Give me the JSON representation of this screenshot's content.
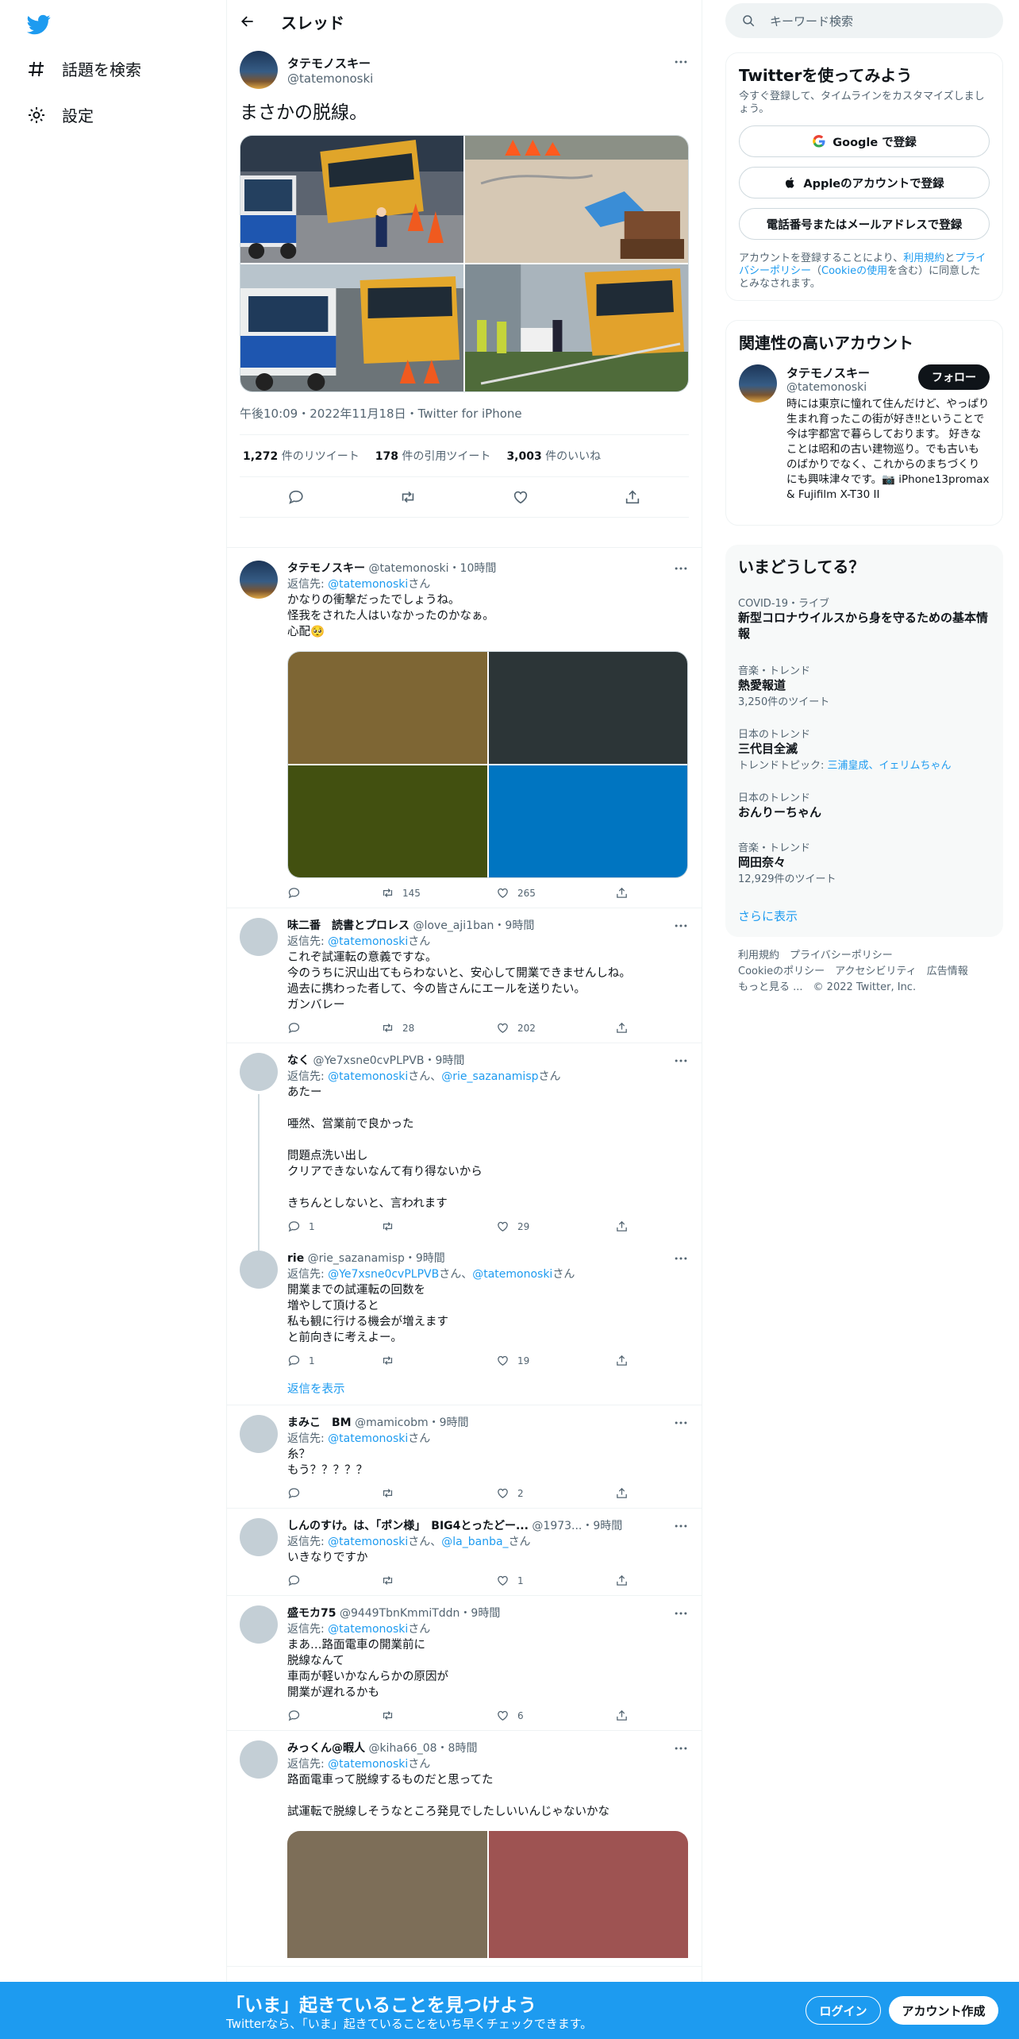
{
  "nav": {
    "explore_label": "話題を検索",
    "settings_label": "設定"
  },
  "header": {
    "title": "スレッド"
  },
  "focus_tweet": {
    "name": "タテモノスキー",
    "handle": "@tatemonoski",
    "text": "まさかの脱線。",
    "meta": "午後10:09・2022年11月18日・Twitter for iPhone",
    "retweets_count": "1,272",
    "retweets_label": " 件のリツイート",
    "quotes_count": "178",
    "quotes_label": " 件の引用ツイート",
    "likes_count": "3,003",
    "likes_label": " 件のいいね"
  },
  "replies": [
    {
      "name": "タテモノスキー",
      "handle": "@tatemonoski",
      "time": "・10時間",
      "to_prefix": "返信先: ",
      "to": "@tatemonoski",
      "to_suffix": "さん",
      "body": "かなりの衝撃だったでしょうね。\n怪我をされた人はいなかったのかなぁ。\n心配🥺",
      "replies": "",
      "retweets": "145",
      "likes": "265",
      "media_colors": [
        "#7e6634",
        "#2c3537",
        "#425010",
        "#0075c1"
      ]
    },
    {
      "name": "味二番　読書とプロレス",
      "handle": "@love_aji1ban",
      "time": "・9時間",
      "to_prefix": "返信先: ",
      "to": "@tatemonoski",
      "to_suffix": "さん",
      "body": "これぞ試運転の意義ですな。\n今のうちに沢山出てもらわないと、安心して開業できませんしね。\n過去に携わった者して、今の皆さんにエールを送りたい。\nガンバレー",
      "replies": "",
      "retweets": "28",
      "likes": "202"
    },
    {
      "name": "なく",
      "handle": "@Ye7xsne0cvPLPVB",
      "time": "・9時間",
      "to_prefix": "返信先: ",
      "to": "@tatemonoski",
      "to_mid": "さん、",
      "to2": "@rie_sazanamisp",
      "to_suffix": "さん",
      "body": "あたー\n\n唖然、営業前で良かった\n\n問題点洗い出し\nクリアできないなんて有り得ないから\n\nきちんとしないと、言われます",
      "replies": "1",
      "retweets": "",
      "likes": "29"
    },
    {
      "name": "rie",
      "handle": "@rie_sazanamisp",
      "time": "・9時間",
      "to_prefix": "返信先: ",
      "to": "@Ye7xsne0cvPLPVB",
      "to_mid": "さん、",
      "to2": "@tatemonoski",
      "to_suffix": "さん",
      "body": "開業までの試運転の回数を\n増やして頂けると\n私も観に行ける機会が増えます\nと前向きに考えよー。",
      "replies": "1",
      "retweets": "",
      "likes": "19",
      "show_replies": "返信を表示"
    },
    {
      "name": "まみこ　BM",
      "handle": "@mamicobm",
      "time": "・9時間",
      "to_prefix": "返信先: ",
      "to": "@tatemonoski",
      "to_suffix": "さん",
      "body": "糸？\nもう？？？？？",
      "replies": "",
      "retweets": "",
      "likes": "2"
    },
    {
      "name": "しんのすけ。は、「ポン様」　BIG4とったどー...",
      "handle": "@1973...",
      "time": "・9時間",
      "to_prefix": "返信先: ",
      "to": "@tatemonoski",
      "to_mid": "さん、",
      "to2": "@la_banba_",
      "to_suffix": "さん",
      "body": "いきなりですか",
      "replies": "",
      "retweets": "",
      "likes": "1"
    },
    {
      "name": "盛モカ75",
      "handle": "@9449TbnKmmiTddn",
      "time": "・9時間",
      "to_prefix": "返信先: ",
      "to": "@tatemonoski",
      "to_suffix": "さん",
      "body": "まあ…路面電車の開業前に\n脱線なんて\n車両が軽いかなんらかの原因が\n開業が遅れるかも",
      "replies": "",
      "retweets": "",
      "likes": "6"
    },
    {
      "name": "みっくん@暇人",
      "handle": "@kiha66_08",
      "time": "・8時間",
      "to_prefix": "返信先: ",
      "to": "@tatemonoski",
      "to_suffix": "さん",
      "body": "路面電車って脱線するものだと思ってた\n\n試運転で脱線しそうなところ発見でしたしいいんじゃないかな",
      "media_colors": [
        "#7d6e58",
        "#9e5352"
      ]
    }
  ],
  "sidebar": {
    "search_placeholder": "キーワード検索",
    "signup": {
      "title": "Twitterを使ってみよう",
      "subtitle": "今すぐ登録して、タイムラインをカスタマイズしましょう。",
      "google": "Google で登録",
      "apple": "Appleのアカウントで登録",
      "phone": "電話番号またはメールアドレスで登録",
      "legal_1": "アカウントを登録することにより、",
      "legal_terms": "利用規約",
      "legal_2": "と",
      "legal_privacy": "プライバシーポリシー",
      "legal_3": "（",
      "legal_cookie": "Cookieの使用",
      "legal_4": "を含む）に同意したとみなされます。"
    },
    "related": {
      "title": "関連性の高いアカウント",
      "name": "タテモノスキー",
      "handle": "@tatemonoski",
      "follow": "フォロー",
      "bio": "時には東京に憧れて住んだけど、やっぱり生まれ育ったこの街が好き‼ということで今は宇都宮で暮らしております。 好きなことは昭和の古い建物巡り。でも古いものばかりでなく、これからのまちづくりにも興味津々です。📷 iPhone13promax & Fujifilm X-T30 II"
    },
    "trends": {
      "title": "いまどうしてる？",
      "items": [
        {
          "cat": "COVID-19・ライブ",
          "name": "新型コロナウイルスから身を守るための基本情報",
          "extra": ""
        },
        {
          "cat": "音楽・トレンド",
          "name": "熱愛報道",
          "extra": "3,250件のツイート"
        },
        {
          "cat": "日本のトレンド",
          "name": "三代目全滅",
          "extra_prefix": "トレンドトピック: ",
          "extra_link": "三浦皇成、イェリムちゃん"
        },
        {
          "cat": "日本のトレンド",
          "name": "おんりーちゃん",
          "extra": ""
        },
        {
          "cat": "音楽・トレンド",
          "name": "岡田奈々",
          "extra": "12,929件のツイート"
        }
      ],
      "more": "さらに表示"
    },
    "footer": {
      "l1": "利用規約",
      "l2": "プライバシーポリシー",
      "l3": "Cookieのポリシー",
      "l4": "アクセシビリティ",
      "l5": "広告情報",
      "l6": "もっと見る ...",
      "copy": "© 2022 Twitter, Inc."
    }
  },
  "bottom_bar": {
    "headline": "「いま」起きていることを見つけよう",
    "sub": "Twitterなら、「いま」起きていることをいち早くチェックできます。",
    "login": "ログイン",
    "signup": "アカウント作成"
  },
  "colors": {
    "brand": "#1d9bf0",
    "text": "#0f1419",
    "muted": "#536471"
  }
}
